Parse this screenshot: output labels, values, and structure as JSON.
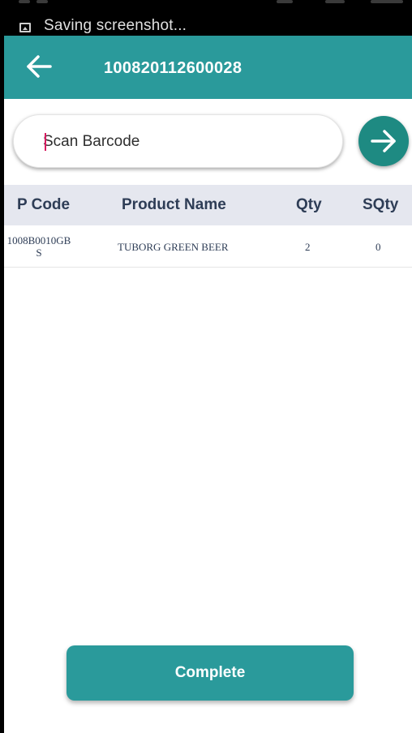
{
  "status_bar": {
    "notification_text": "Saving screenshot...",
    "notification_icon": "image-icon"
  },
  "app_bar": {
    "title": "100820112600028",
    "back_icon": "arrow-left-icon",
    "color": "#2a9a9b"
  },
  "search": {
    "placeholder": "Scan Barcode",
    "value": "",
    "submit_icon": "arrow-right-icon",
    "submit_color": "#1e8a82"
  },
  "table": {
    "columns": [
      "P Code",
      "Product Name",
      "Qty",
      "SQty"
    ],
    "rows": [
      {
        "p_code_line1": "1008B0010GB",
        "p_code_line2": "S",
        "product_name": "TUBORG GREEN BEER",
        "qty": "2",
        "sqty": "0"
      }
    ],
    "header_bg": "#e5e7ef",
    "text_color": "#2e3d56"
  },
  "footer": {
    "complete_label": "Complete"
  }
}
